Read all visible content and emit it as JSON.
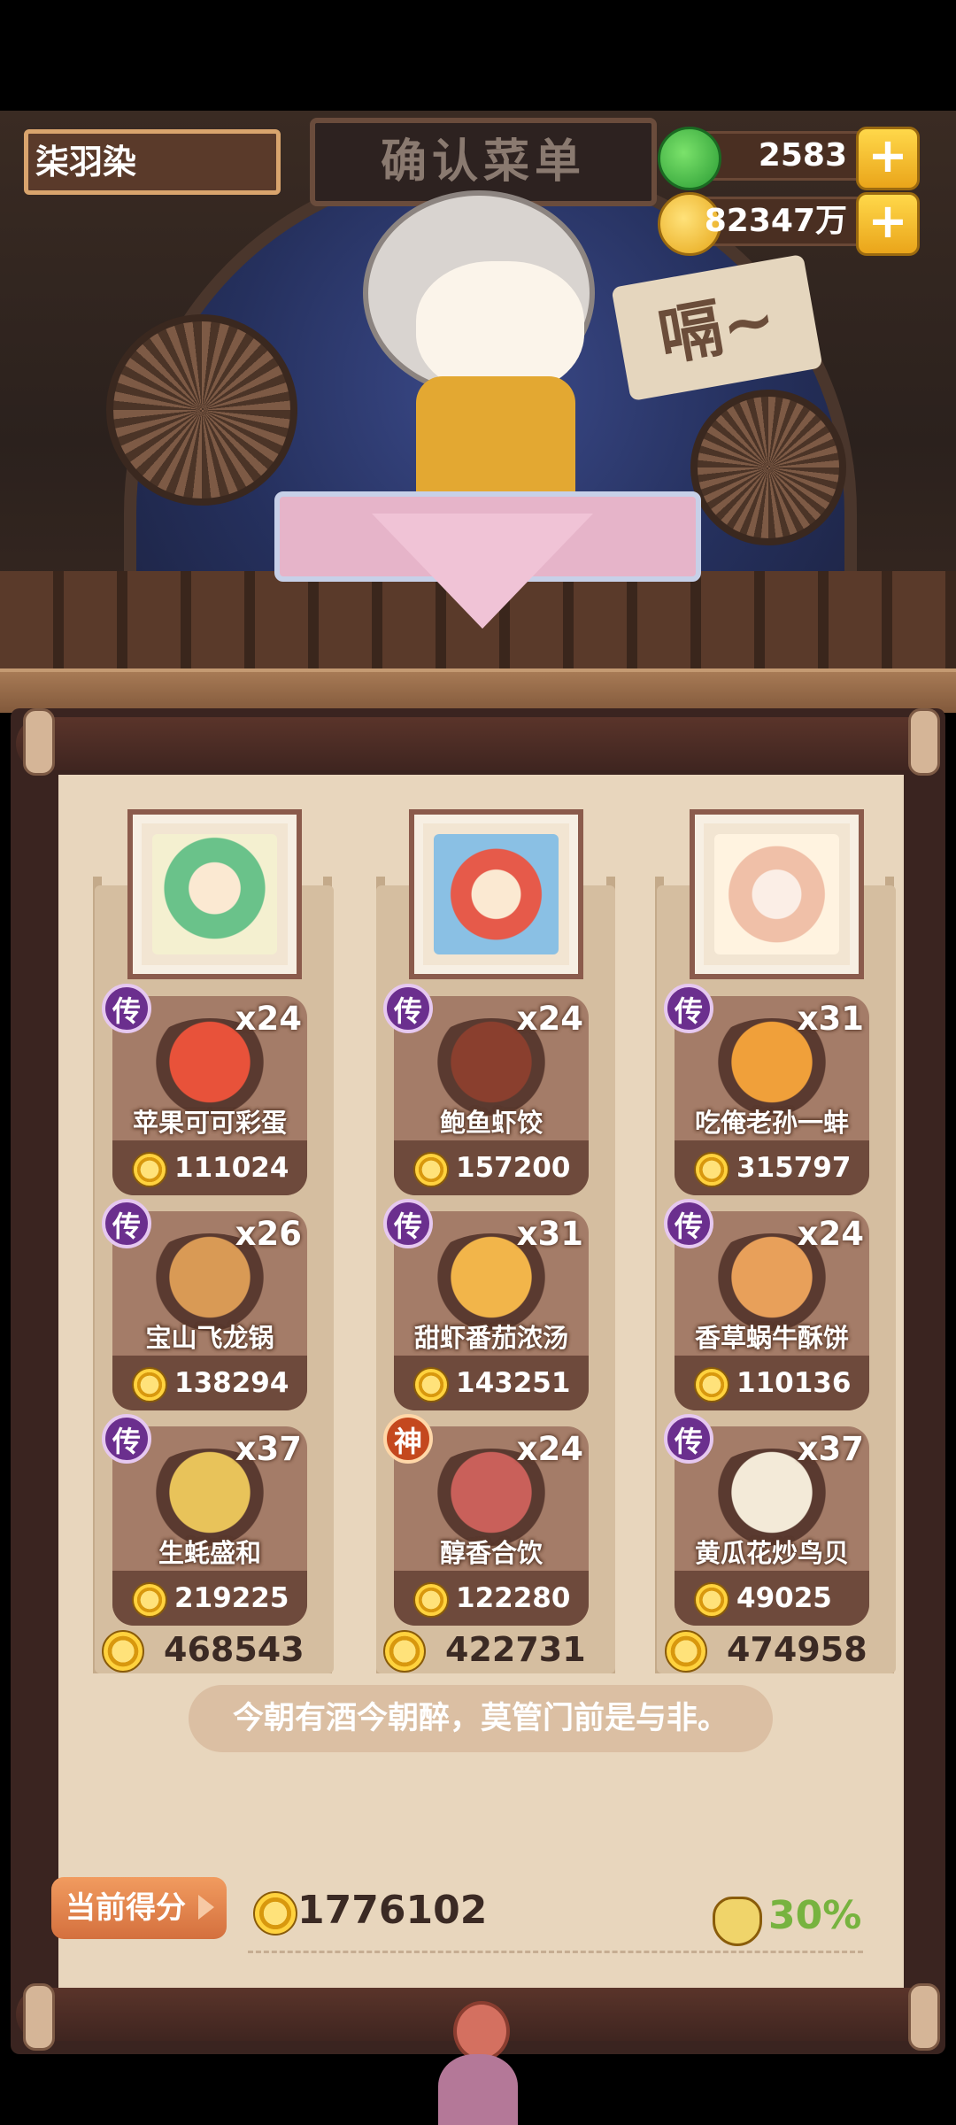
{
  "player": {
    "name": "柒羽染"
  },
  "resources": {
    "jade": "2583",
    "coins": "82347万"
  },
  "scene": {
    "sign": "确认菜单",
    "bubble": "嗝~"
  },
  "columns": [
    {
      "total": "468543",
      "dishes": [
        {
          "grade": "传",
          "qty": "x24",
          "name": "苹果可可彩蛋",
          "price": "111024",
          "color": "#e8523a"
        },
        {
          "grade": "传",
          "qty": "x26",
          "name": "宝山飞龙锅",
          "price": "138294",
          "color": "#d99a55"
        },
        {
          "grade": "传",
          "qty": "x37",
          "name": "生蚝盛和",
          "price": "219225",
          "color": "#e8c35a"
        }
      ]
    },
    {
      "total": "422731",
      "dishes": [
        {
          "grade": "传",
          "qty": "x24",
          "name": "鲍鱼虾饺",
          "price": "157200",
          "color": "#8a3f2e"
        },
        {
          "grade": "传",
          "qty": "x31",
          "name": "甜虾番茄浓汤",
          "price": "143251",
          "color": "#f2b54a"
        },
        {
          "grade": "神",
          "qty": "x24",
          "name": "醇香合饮",
          "price": "122280",
          "color": "#c9605a"
        }
      ]
    },
    {
      "total": "474958",
      "dishes": [
        {
          "grade": "传",
          "qty": "x31",
          "name": "吃俺老孙一蚌",
          "price": "315797",
          "color": "#f0a03a"
        },
        {
          "grade": "传",
          "qty": "x24",
          "name": "香草蜗牛酥饼",
          "price": "110136",
          "color": "#e8a05a"
        },
        {
          "grade": "传",
          "qty": "x37",
          "name": "黄瓜花炒鸟贝",
          "price": "49025",
          "color": "#f3ead8"
        }
      ]
    }
  ],
  "quote": "今朝有酒今朝醉，莫管门前是与非。",
  "score": {
    "label": "当前得分",
    "value": "1776102",
    "bonus": "30%"
  }
}
